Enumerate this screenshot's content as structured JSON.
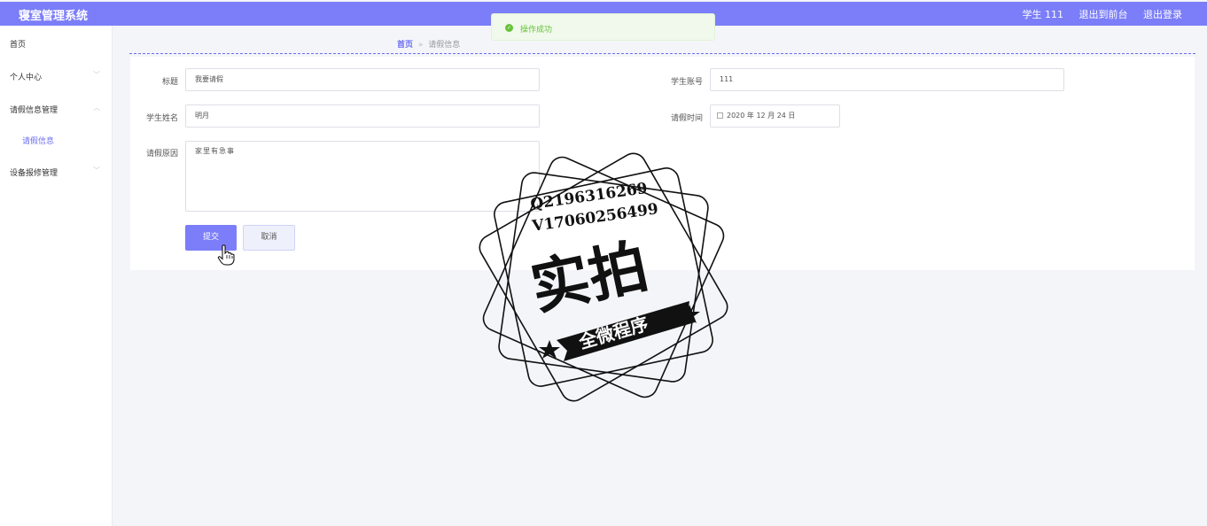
{
  "header": {
    "title": "寝室管理系统",
    "user": "学生 111",
    "back_to_front": "退出到前台",
    "logout": "退出登录"
  },
  "sidebar": {
    "items": [
      {
        "label": "首页"
      },
      {
        "label": "个人中心"
      },
      {
        "label": "请假信息管理"
      },
      {
        "label": "请假信息"
      },
      {
        "label": "设备报修管理"
      }
    ]
  },
  "breadcrumb": {
    "home": "首页",
    "separator": "»",
    "current": "请假信息"
  },
  "toast": {
    "message": "操作成功"
  },
  "form": {
    "title_label": "标题",
    "title_value": "我要请假",
    "account_label": "学生账号",
    "account_value": "111",
    "name_label": "学生姓名",
    "name_value": "明月",
    "time_label": "请假时间",
    "time_value": "2020 年 12 月 24 日",
    "reason_label": "请假原因",
    "reason_value": "家里有急事",
    "submit_label": "提交",
    "cancel_label": "取消"
  },
  "stamp": {
    "line1": "Q2196316269",
    "line2": "V17060256499",
    "main": "实拍",
    "banner": "全微程序"
  },
  "colors": {
    "accent": "#7b7ef8",
    "success": "#67c23a"
  }
}
